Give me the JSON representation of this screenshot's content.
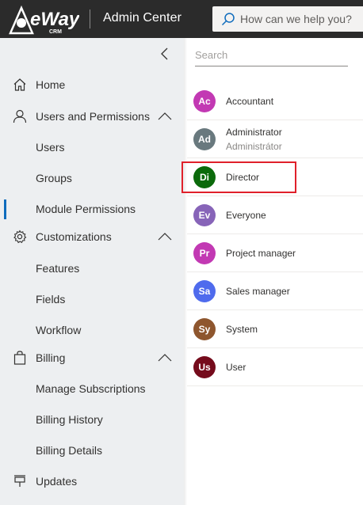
{
  "header": {
    "logo_text": "eWay",
    "logo_sub": "CRM",
    "app_title": "Admin Center",
    "help_placeholder": "How can we help you?"
  },
  "sidebar": {
    "collapse_icon": "chevron-left-icon",
    "items": [
      {
        "label": "Home",
        "icon": "home-icon"
      },
      {
        "label": "Users and Permissions",
        "icon": "person-icon",
        "expanded": true,
        "children": [
          {
            "label": "Users"
          },
          {
            "label": "Groups"
          },
          {
            "label": "Module Permissions",
            "active": true
          }
        ]
      },
      {
        "label": "Customizations",
        "icon": "gear-icon",
        "expanded": true,
        "children": [
          {
            "label": "Features"
          },
          {
            "label": "Fields"
          },
          {
            "label": "Workflow"
          }
        ]
      },
      {
        "label": "Billing",
        "icon": "shopping-bag-icon",
        "expanded": true,
        "children": [
          {
            "label": "Manage Subscriptions"
          },
          {
            "label": "Billing History"
          },
          {
            "label": "Billing Details"
          }
        ]
      },
      {
        "label": "Updates",
        "icon": "upload-icon"
      }
    ]
  },
  "list": {
    "search_placeholder": "Search",
    "groups": [
      {
        "initials": "Ac",
        "name": "Accountant",
        "color": "#c239b3"
      },
      {
        "initials": "Ad",
        "name": "Administrator",
        "subtitle": "Administrátor",
        "color": "#69797e"
      },
      {
        "initials": "Di",
        "name": "Director",
        "color": "#0b6a0b",
        "highlighted": true
      },
      {
        "initials": "Ev",
        "name": "Everyone",
        "color": "#8764b8"
      },
      {
        "initials": "Pr",
        "name": "Project manager",
        "color": "#c239b3"
      },
      {
        "initials": "Sa",
        "name": "Sales manager",
        "color": "#4f6bed"
      },
      {
        "initials": "Sy",
        "name": "System",
        "color": "#8e562e"
      },
      {
        "initials": "Us",
        "name": "User",
        "color": "#750b1c"
      }
    ]
  },
  "colors": {
    "accent": "#0f6cbd",
    "highlight": "#e0202a",
    "topbar": "#2b2b2b",
    "sidebar": "#edeff1"
  }
}
